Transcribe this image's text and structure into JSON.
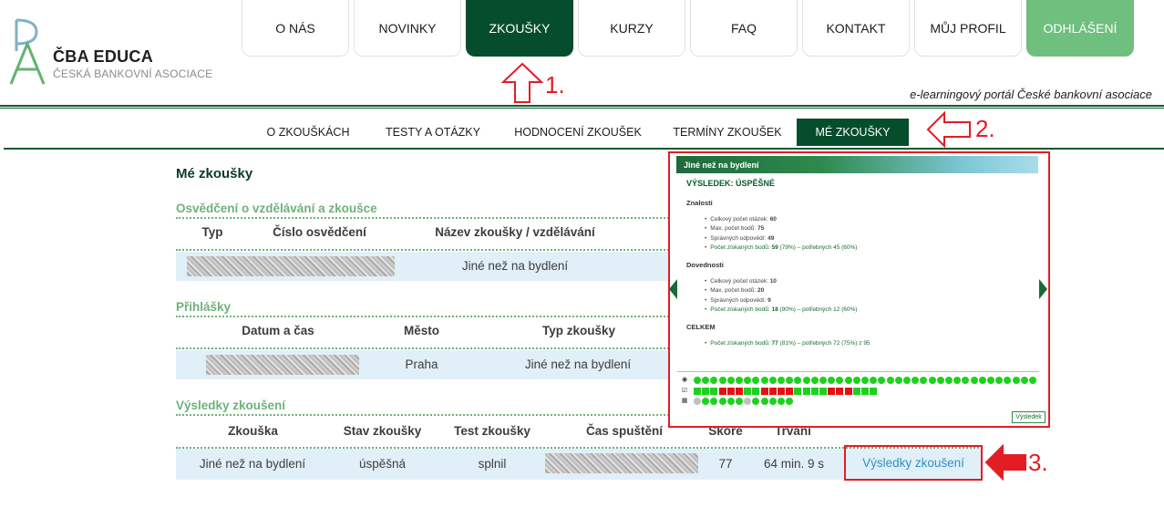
{
  "brand": {
    "name": "ČBA EDUCA",
    "subtitle": "ČESKÁ BANKOVNÍ ASOCIACE",
    "tagline": "e-learningový portál České bankovní asociace",
    "colors": {
      "dark_green": "#064d2c",
      "light_green": "#6fbf7e",
      "accent_red": "#e31d24",
      "link_blue": "#2f91c6"
    }
  },
  "top_nav": [
    {
      "label": "O NÁS"
    },
    {
      "label": "NOVINKY"
    },
    {
      "label": "ZKOUŠKY",
      "active": true
    },
    {
      "label": "KURZY"
    },
    {
      "label": "FAQ"
    },
    {
      "label": "KONTAKT"
    },
    {
      "label": "MŮJ PROFIL"
    },
    {
      "label": "ODHLÁŠENÍ"
    }
  ],
  "sub_nav": [
    {
      "label": "O ZKOUŠKÁCH"
    },
    {
      "label": "TESTY A OTÁZKY"
    },
    {
      "label": "HODNOCENÍ ZKOUŠEK"
    },
    {
      "label": "TERMÍNY ZKOUŠEK"
    },
    {
      "label": "MÉ ZKOUŠKY",
      "active": true
    }
  ],
  "main": {
    "title": "Mé zkoušky",
    "certificates": {
      "title": "Osvědčení o vzdělávání a zkoušce",
      "headers": [
        "Typ",
        "Číslo osvědčení",
        "Název zkoušky / vzdělávání"
      ],
      "rows": [
        {
          "name": "Jiné než na bydlení"
        }
      ]
    },
    "applications": {
      "title": "Přihlášky",
      "headers": [
        "Datum a čas",
        "Město",
        "Typ zkoušky"
      ],
      "rows": [
        {
          "city": "Praha",
          "type": "Jiné než na bydlení"
        }
      ]
    },
    "results": {
      "title": "Výsledky zkoušení",
      "headers": [
        "Zkouška",
        "Stav zkoušky",
        "Test zkoušky",
        "Čas spuštění",
        "Skóre",
        "Trvání"
      ],
      "rows": [
        {
          "exam": "Jiné než na bydlení",
          "status": "úspěšná",
          "test": "splnil",
          "score": "77",
          "duration": "64 min. 9 s",
          "link": "Výsledky zkoušení"
        }
      ]
    }
  },
  "popup": {
    "title": "Jiné než na bydlení",
    "result": "VÝSLEDEK: ÚSPĚŠNÉ",
    "knowledge": {
      "title": "Znalosti",
      "questions_label": "Celkový počet otázek:",
      "questions": "60",
      "max_label": "Max. počet bodů:",
      "max": "75",
      "correct_label": "Správných odpovědí:",
      "correct": "49",
      "earned_label": "Počet získaných bodů:",
      "earned": "59",
      "earned_rest": "(79%) – potřebných 45 (60%)"
    },
    "skills": {
      "title": "Dovednosti",
      "questions_label": "Celkový počet otázek:",
      "questions": "10",
      "max_label": "Max. počet bodů:",
      "max": "20",
      "correct_label": "Správných odpovědí:",
      "correct": "9",
      "earned_label": "Počet získaných bodů:",
      "earned": "18",
      "earned_rest": "(90%) – potřebných 12 (60%)"
    },
    "total": {
      "title": "CELKEM",
      "earned_label": "Počet získaných bodů:",
      "earned": "77",
      "earned_rest": "(81%) – potřebných 72 (75%) z 95"
    },
    "answer_rows": [
      "gggggggggggggggggggggggggggggggggggggggggggggggggggggggggggggggggggggggggggggggggggg",
      "gggrrrggrrrrggggrrrggg",
      "ygggggyggggg"
    ],
    "button": "Výsledek"
  },
  "annotations": [
    "1.",
    "2.",
    "3."
  ]
}
